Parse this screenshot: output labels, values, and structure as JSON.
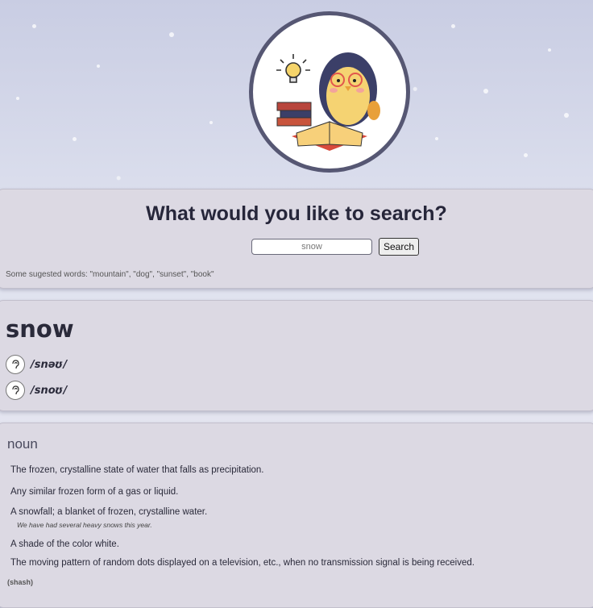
{
  "search": {
    "title": "What would you like to search?",
    "value": "snow",
    "button_label": "Search",
    "suggestions": "Some sugested words: \"mountain\", \"dog\", \"sunset\", \"book\""
  },
  "entry": {
    "word": "snow",
    "phonetics": [
      {
        "text": "/snəʊ/",
        "icon": "ear-icon"
      },
      {
        "text": "/snoʊ/",
        "icon": "ear-icon"
      }
    ]
  },
  "meaning": {
    "part_of_speech": "noun",
    "definitions": [
      {
        "text": "The frozen, crystalline state of water that falls as precipitation."
      },
      {
        "text": "Any similar frozen form of a gas or liquid."
      },
      {
        "text": "A snowfall; a blanket of frozen, crystalline water.",
        "example": "We have had several heavy snows this year."
      },
      {
        "text": "A shade of the color white."
      },
      {
        "text": "The moving pattern of random dots displayed on a television, etc., when no transmission signal is being received."
      }
    ],
    "tag": "(shash)"
  },
  "colors": {
    "card": "#dcd9e3",
    "logo_ring": "#565773",
    "title": "#26263a"
  }
}
